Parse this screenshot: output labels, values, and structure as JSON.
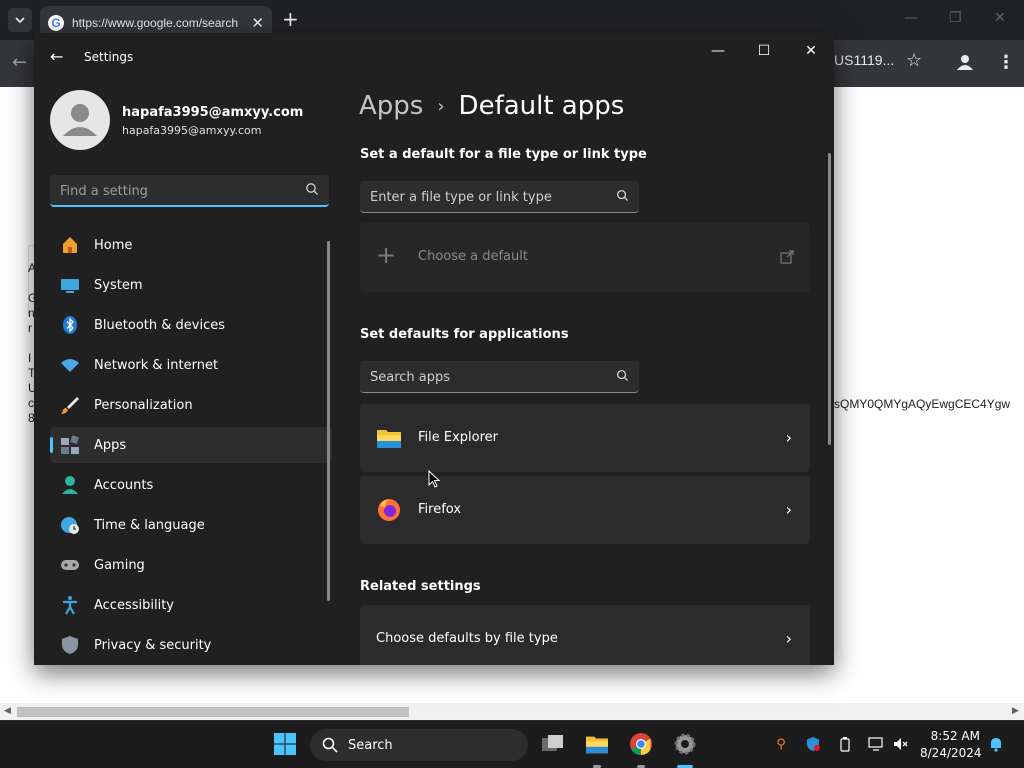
{
  "browser": {
    "tab_title": "https://www.google.com/search",
    "omnibox_tail": "US1119...",
    "page_snippet": "sQMY0QMYgAQyEwgCEC4Ygw",
    "page_fragments": [
      "A",
      "G",
      "n",
      "r",
      "I",
      "T",
      "U",
      "c",
      "8"
    ]
  },
  "settings": {
    "window_title": "Settings",
    "user": {
      "name": "hapafa3995@amxyy.com",
      "email": "hapafa3995@amxyy.com"
    },
    "find_placeholder": "Find a setting",
    "nav": [
      {
        "label": "Home",
        "icon": "home-icon"
      },
      {
        "label": "System",
        "icon": "system-icon"
      },
      {
        "label": "Bluetooth & devices",
        "icon": "bluetooth-icon"
      },
      {
        "label": "Network & internet",
        "icon": "wifi-icon"
      },
      {
        "label": "Personalization",
        "icon": "brush-icon"
      },
      {
        "label": "Apps",
        "icon": "apps-icon",
        "selected": true
      },
      {
        "label": "Accounts",
        "icon": "accounts-icon"
      },
      {
        "label": "Time & language",
        "icon": "globe-clock-icon"
      },
      {
        "label": "Gaming",
        "icon": "gamepad-icon"
      },
      {
        "label": "Accessibility",
        "icon": "accessibility-icon"
      },
      {
        "label": "Privacy & security",
        "icon": "shield-icon"
      }
    ],
    "breadcrumb": {
      "parent": "Apps",
      "separator": "›",
      "current": "Default apps"
    },
    "file_type_section": {
      "heading": "Set a default for a file type or link type",
      "search_placeholder": "Enter a file type or link type",
      "choose_default_label": "Choose a default"
    },
    "apps_section": {
      "heading": "Set defaults for applications",
      "search_placeholder": "Search apps",
      "apps": [
        {
          "name": "File Explorer",
          "icon": "file-explorer-icon"
        },
        {
          "name": "Firefox",
          "icon": "firefox-icon"
        }
      ]
    },
    "related_section": {
      "heading": "Related settings",
      "items": [
        {
          "label": "Choose defaults by file type"
        }
      ]
    }
  },
  "taskbar": {
    "search_label": "Search",
    "time": "8:52 AM",
    "date": "8/24/2024"
  },
  "colors": {
    "accent": "#4cc2ff",
    "window_bg": "#202020",
    "card_bg": "#2b2b2b",
    "taskbar_bg": "#1c1c1c"
  }
}
